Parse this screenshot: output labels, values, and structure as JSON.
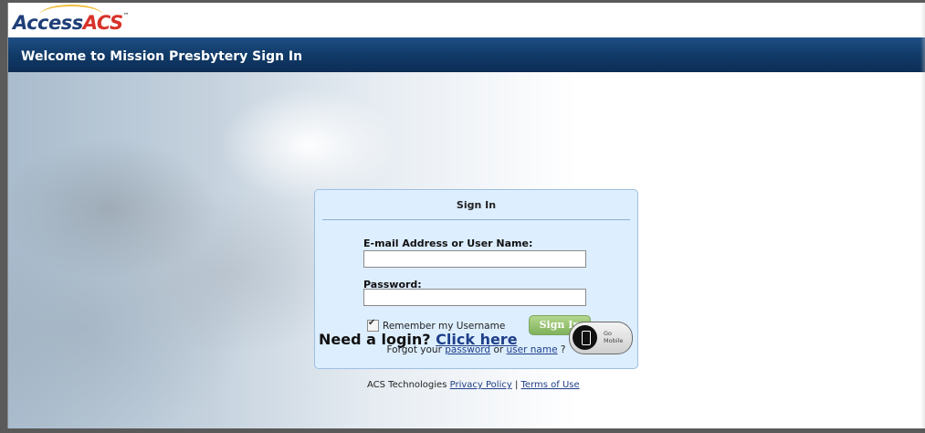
{
  "brand": {
    "logo_part1": "Access",
    "logo_part2": "ACS",
    "trademark": "™"
  },
  "header": {
    "title": "Welcome to Mission Presbytery Sign In"
  },
  "login": {
    "title": "Sign In",
    "email_label": "E-mail Address or User Name:",
    "email_value": "",
    "password_label": "Password:",
    "password_value": "",
    "remember_label": "Remember my Username",
    "remember_checked": true,
    "signin_label": "Sign In",
    "forgot_prefix": "Forgot your",
    "forgot_password_link": "password",
    "forgot_or": "or",
    "forgot_username_link": "user name",
    "forgot_suffix": "?"
  },
  "need_login": {
    "text": "Need a login?",
    "link": "Click here"
  },
  "go_mobile": {
    "line1": "Go",
    "line2": "Mobile",
    "icon": "phone-icon"
  },
  "footer": {
    "company": "ACS Technologies",
    "privacy_link": "Privacy Policy",
    "separator": "|",
    "terms_link": "Terms of Use"
  },
  "colors": {
    "title_bar": "#123c6b",
    "logo_blue": "#1f3f78",
    "logo_red": "#d8322a",
    "signin_green": "#7fb15a",
    "login_box_bg": "#ddeeff",
    "link": "#1f3f88"
  }
}
